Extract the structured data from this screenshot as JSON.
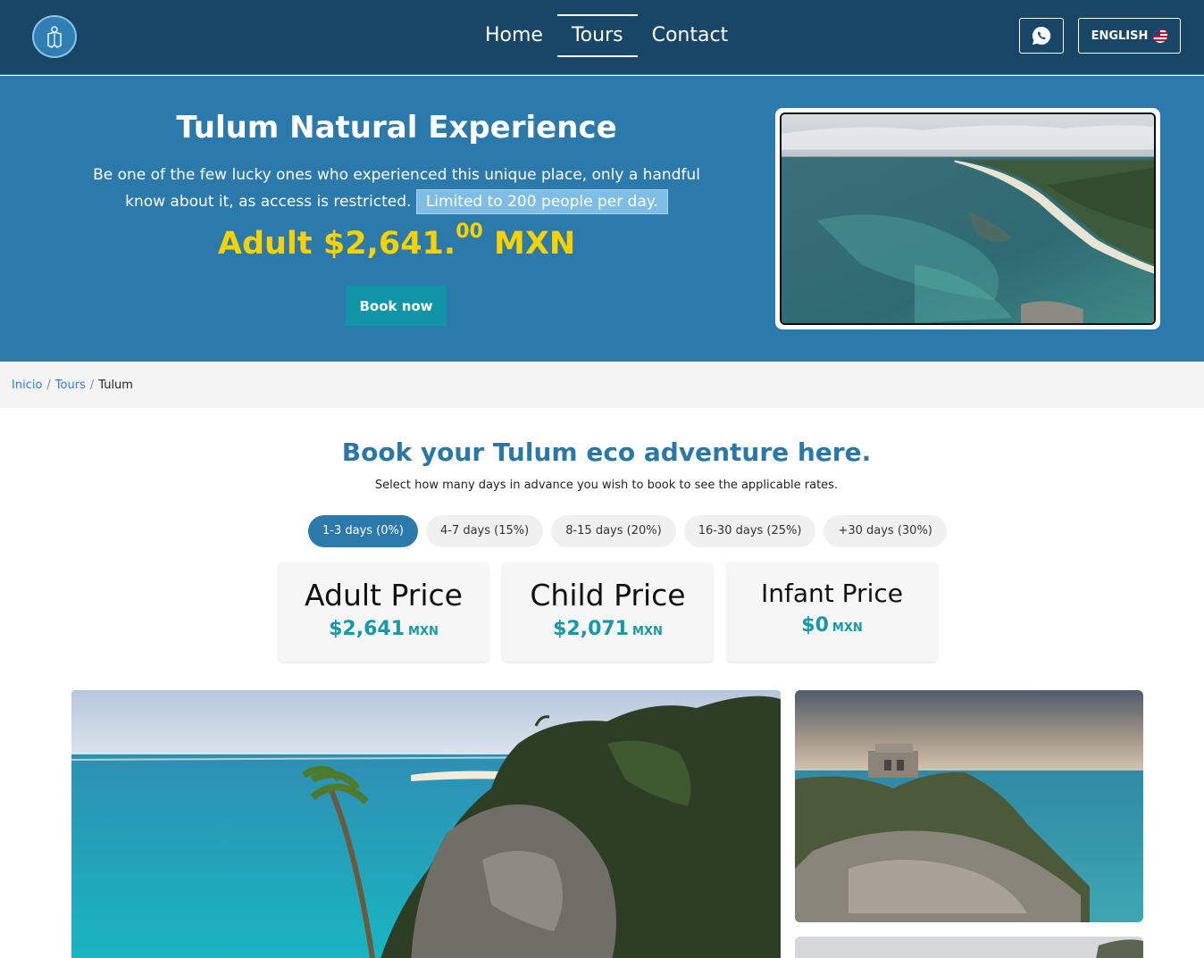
{
  "nav": {
    "links": [
      "Home",
      "Tours",
      "Contact"
    ],
    "active": "Tours",
    "language": "ENGLISH"
  },
  "hero": {
    "title": "Tulum Natural Experience",
    "description": "Be one of the few lucky ones who experienced this unique place, only a handful know about it, as access is restricted.",
    "highlight": "Limited to 200 people per day.",
    "price_prefix": "Adult $2,641.",
    "price_cents": "00",
    "price_currency": "MXN",
    "book_label": "Book now"
  },
  "breadcrumb": {
    "items": [
      "Inicio",
      "Tours"
    ],
    "current": "Tulum"
  },
  "booking": {
    "title": "Book your Tulum eco adventure here.",
    "subtitle": "Select how many days in advance you wish to book to see the applicable rates.",
    "options": [
      "1-3 days (0%)",
      "4-7 days (15%)",
      "8-15 days (20%)",
      "16-30 days (25%)",
      "+30 days (30%)"
    ],
    "selected": "1-3 days (0%)",
    "prices": [
      {
        "label": "Adult Price",
        "amount": "$2,641",
        "currency": "MXN"
      },
      {
        "label": "Child Price",
        "amount": "$2,071",
        "currency": "MXN"
      },
      {
        "label": "Infant Price",
        "amount": "$0",
        "currency": "MXN"
      }
    ]
  },
  "colors": {
    "navbar": "#184666",
    "hero": "#2b7aab",
    "price_yellow": "#f7d100",
    "teal": "#1196a8"
  }
}
